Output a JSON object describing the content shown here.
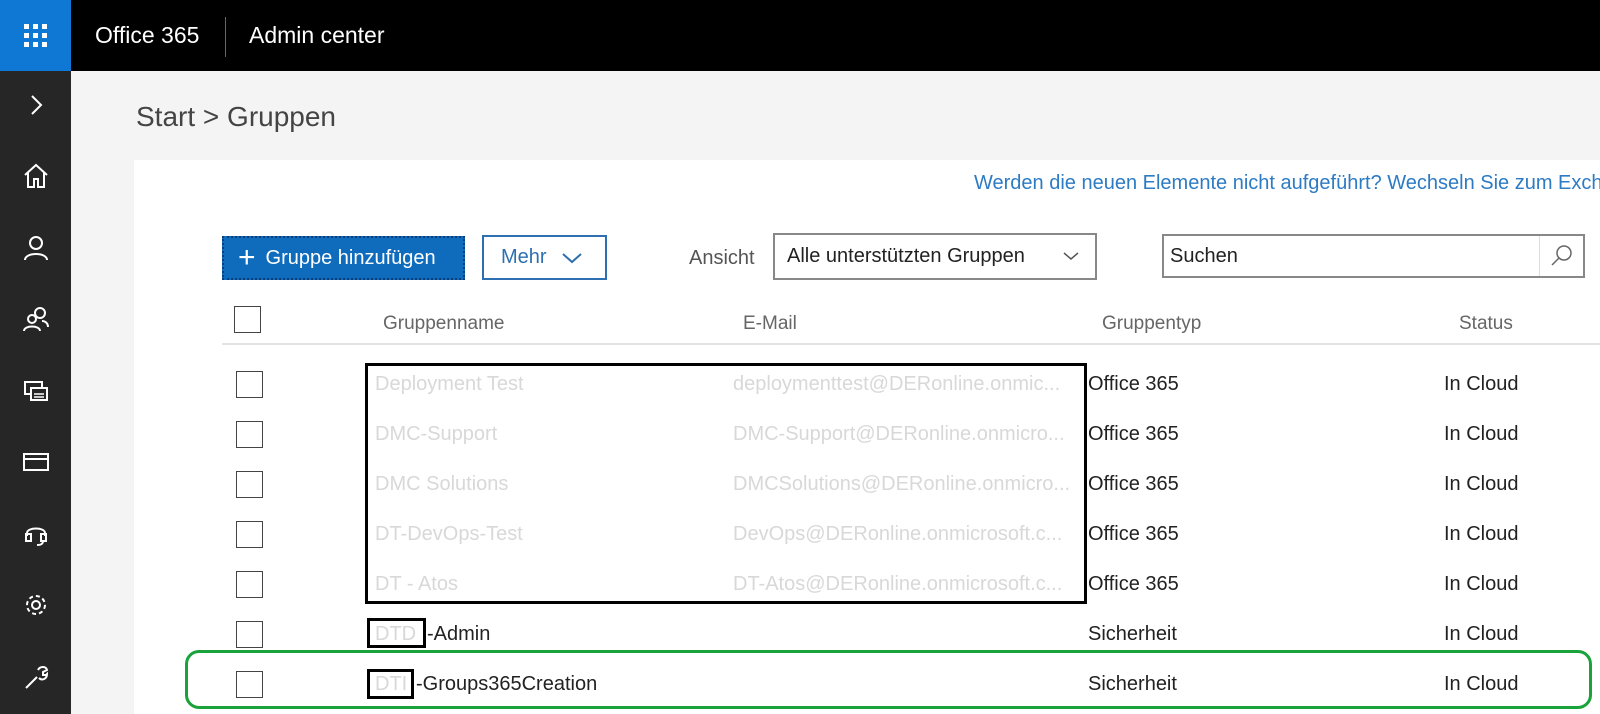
{
  "topbar": {
    "brand": "Office 365",
    "app_name": "Admin center"
  },
  "rail": {
    "items": [
      {
        "icon": "chevron-right-icon"
      },
      {
        "icon": "home-icon"
      },
      {
        "icon": "user-icon"
      },
      {
        "icon": "groups-icon"
      },
      {
        "icon": "devices-icon"
      },
      {
        "icon": "billing-card-icon"
      },
      {
        "icon": "support-headset-icon"
      },
      {
        "icon": "settings-gear-icon"
      },
      {
        "icon": "setup-wrench-icon"
      }
    ]
  },
  "breadcrumb": "Start > Gruppen",
  "notice": "Werden die neuen Elemente nicht aufgeführt? Wechseln Sie zum Exch",
  "toolbar": {
    "add_label": "Gruppe hinzufügen",
    "more_label": "Mehr",
    "view_label": "Ansicht",
    "view_selected": "Alle unterstützten Gruppen",
    "search_placeholder": "Suchen"
  },
  "table": {
    "headers": {
      "name": "Gruppenname",
      "email": "E-Mail",
      "type": "Gruppentyp",
      "status": "Status"
    },
    "rows": [
      {
        "name": "Deployment Test",
        "email": "deploymenttest@DERonline.onmic...",
        "type": "Office 365",
        "status": "In Cloud"
      },
      {
        "name": "DMC-Support",
        "email": "DMC-Support@DERonline.onmicro...",
        "type": "Office 365",
        "status": "In Cloud"
      },
      {
        "name": "DMC Solutions",
        "email": "DMCSolutions@DERonline.onmicro...",
        "type": "Office 365",
        "status": "In Cloud"
      },
      {
        "name": "DT-DevOps-Test",
        "email": "DevOps@DERonline.onmicrosoft.c...",
        "type": "Office 365",
        "status": "In Cloud"
      },
      {
        "name": "DT - Atos",
        "email": "DT-Atos@DERonline.onmicrosoft.c...",
        "type": "Office 365",
        "status": "In Cloud"
      },
      {
        "prefix": "DTD",
        "name": "-Admin",
        "email": "",
        "type": "Sicherheit",
        "status": "In Cloud"
      },
      {
        "prefix": "DTI",
        "name": "-Groups365Creation",
        "email": "",
        "type": "Sicherheit",
        "status": "In Cloud"
      }
    ]
  },
  "colors": {
    "accent": "#0f78d4",
    "link": "#2d7bc4",
    "highlight": "#19a33a"
  }
}
